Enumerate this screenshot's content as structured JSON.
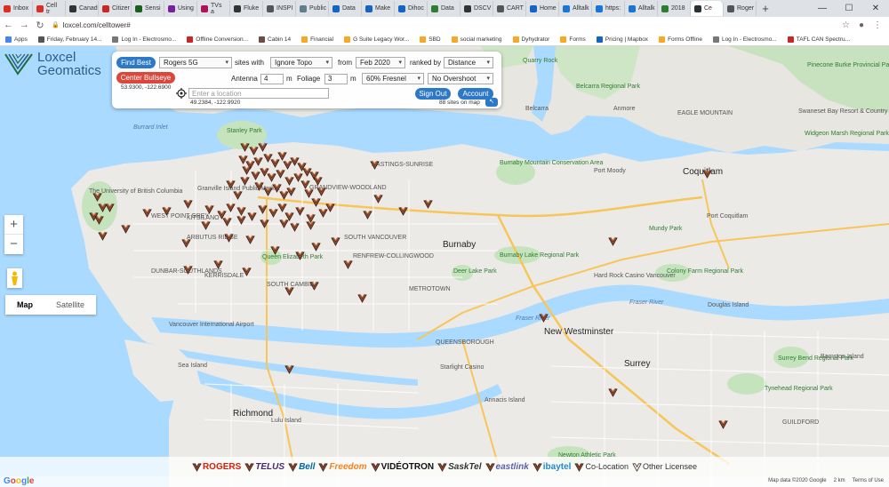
{
  "browser": {
    "tabs": [
      {
        "label": "Inbox",
        "color": "#d93025"
      },
      {
        "label": "Cell tr",
        "color": "#d93025"
      },
      {
        "label": "Canad",
        "color": "#333333"
      },
      {
        "label": "Citizer",
        "color": "#c62828"
      },
      {
        "label": "Sensi",
        "color": "#1b5e20"
      },
      {
        "label": "Using",
        "color": "#7b1fa2"
      },
      {
        "label": "TVs a",
        "color": "#ad1457"
      },
      {
        "label": "Fluke",
        "color": "#333333"
      },
      {
        "label": "INSPI",
        "color": "#555555"
      },
      {
        "label": "Public",
        "color": "#607d8b"
      },
      {
        "label": "Data",
        "color": "#1565c0"
      },
      {
        "label": "Make",
        "color": "#1565c0"
      },
      {
        "label": "Dihoc",
        "color": "#1565c0"
      },
      {
        "label": "Data",
        "color": "#2e7d32"
      },
      {
        "label": "DSCV",
        "color": "#333333"
      },
      {
        "label": "CART",
        "color": "#555555"
      },
      {
        "label": "Home",
        "color": "#1565c0"
      },
      {
        "label": "Alltalk",
        "color": "#1976d2"
      },
      {
        "label": "https:",
        "color": "#1976d2"
      },
      {
        "label": "Alltalk",
        "color": "#1976d2"
      },
      {
        "label": "2018",
        "color": "#2e7d32"
      },
      {
        "label": "Ce",
        "color": "#263238",
        "active": true
      },
      {
        "label": "Roger",
        "color": "#555555"
      }
    ],
    "url": "loxcel.com/celltower#",
    "new_tab": "+",
    "window_buttons": [
      "—",
      "☐",
      "✕"
    ],
    "bookmarks": [
      {
        "label": "Apps",
        "color": "#4285f4"
      },
      {
        "label": "Friday, February 14...",
        "color": "#555555"
      },
      {
        "label": "Log In - Electrosmo...",
        "color": "#777777"
      },
      {
        "label": "Offline Conversion...",
        "color": "#c62828"
      },
      {
        "label": "Cabin 14",
        "color": "#6d4c41"
      },
      {
        "label": "Financial",
        "color": "#f9a825"
      },
      {
        "label": "G Suite Legacy Wor...",
        "color": "#f9a825"
      },
      {
        "label": "SBD",
        "color": "#f9a825"
      },
      {
        "label": "social marketing",
        "color": "#f9a825"
      },
      {
        "label": "Dyhydrator",
        "color": "#f9a825"
      },
      {
        "label": "Forms",
        "color": "#f9a825"
      },
      {
        "label": "Pricing | Mapbox",
        "color": "#1565c0"
      },
      {
        "label": "Forms Offline",
        "color": "#f9a825"
      },
      {
        "label": "Log In - Electrosmo...",
        "color": "#777777"
      },
      {
        "label": "TAFL CAN Spectru...",
        "color": "#c62828"
      }
    ]
  },
  "app": {
    "logo_line1": "Loxcel",
    "logo_line2": "Geomatics",
    "find_best": "Find Best",
    "carrier": "Rogers 5G",
    "sites_with": "sites with",
    "topo": "Ignore Topo",
    "from": "from",
    "date": "Feb 2020",
    "ranked_by": "ranked by",
    "rank": "Distance",
    "center_bullseye": "Center Bullseye",
    "bullseye_coords": "53.9300, -122.6900",
    "antenna_label": "Antenna",
    "antenna_value": "4",
    "antenna_unit": "m",
    "foliage_label": "Foliage",
    "foliage_value": "3",
    "foliage_unit": "m",
    "fresnel": "60% Fresnel",
    "overshoot": "No Overshoot",
    "location_placeholder": "Enter a location",
    "location_coords": "49.2384, -122.9920",
    "sign_out": "Sign Out",
    "account": "Account",
    "sites_count": "88 sites on map",
    "collapse": "↖"
  },
  "map": {
    "zoom_in": "+",
    "zoom_out": "−",
    "map_type": [
      "Map",
      "Satellite"
    ],
    "places": [
      {
        "t": "Quarry Rock",
        "c": "green"
      },
      {
        "t": "Belcarra Regional Park",
        "c": "green"
      },
      {
        "t": "Belcarra",
        "c": ""
      },
      {
        "t": "Anmore",
        "c": ""
      },
      {
        "t": "EAGLE MOUNTAIN",
        "c": ""
      },
      {
        "t": "Swaneset Bay Resort & Country Club",
        "c": ""
      },
      {
        "t": "Pinecone Burke Provincial Park",
        "c": "green"
      },
      {
        "t": "Widgeon Marsh Regional Park",
        "c": "green"
      },
      {
        "t": "Stanley Park",
        "c": "green"
      },
      {
        "t": "Burrard Inlet",
        "c": "water"
      },
      {
        "t": "Port Moody",
        "c": ""
      },
      {
        "t": "Coquitlam",
        "c": "city"
      },
      {
        "t": "Port Coquitlam",
        "c": ""
      },
      {
        "t": "Mundy Park",
        "c": "green"
      },
      {
        "t": "Burnaby Mountain Conservation Area",
        "c": "green"
      },
      {
        "t": "Granville Island Public Market",
        "c": ""
      },
      {
        "t": "GRANDVIEW-WOODLAND",
        "c": ""
      },
      {
        "t": "The University of British Columbia",
        "c": ""
      },
      {
        "t": "WEST POINT GREY",
        "c": ""
      },
      {
        "t": "KITSILANO",
        "c": ""
      },
      {
        "t": "ARBUTUS RIDGE",
        "c": ""
      },
      {
        "t": "Burnaby",
        "c": "city"
      },
      {
        "t": "Queen Elizabeth Park",
        "c": "green"
      },
      {
        "t": "Burnaby Lake Regional Park",
        "c": "green"
      },
      {
        "t": "DUNBAR-SOUTHLANDS",
        "c": ""
      },
      {
        "t": "KERRISDALE",
        "c": ""
      },
      {
        "t": "Deer Lake Park",
        "c": "green"
      },
      {
        "t": "Hard Rock Casino Vancouver",
        "c": ""
      },
      {
        "t": "Colony Farm Regional Park",
        "c": "green"
      },
      {
        "t": "METROTOWN",
        "c": ""
      },
      {
        "t": "Douglas Island",
        "c": ""
      },
      {
        "t": "New Westminster",
        "c": "city"
      },
      {
        "t": "Vancouver International Airport",
        "c": ""
      },
      {
        "t": "Sea Island",
        "c": ""
      },
      {
        "t": "Starlight Casino",
        "c": ""
      },
      {
        "t": "Surrey",
        "c": "city"
      },
      {
        "t": "Surrey Bend Regional Park",
        "c": "green"
      },
      {
        "t": "Barnston Island",
        "c": ""
      },
      {
        "t": "Tynehead Regional Park",
        "c": "green"
      },
      {
        "t": "Annacis Island",
        "c": ""
      },
      {
        "t": "Richmond",
        "c": "city"
      },
      {
        "t": "Lulu Island",
        "c": ""
      },
      {
        "t": "Newton Athletic Park",
        "c": "green"
      },
      {
        "t": "Fraser River",
        "c": "water"
      },
      {
        "t": "Fraser River",
        "c": "water"
      },
      {
        "t": "HASTINGS-SUNRISE",
        "c": ""
      },
      {
        "t": "RENFREW-COLLINGWOOD",
        "c": ""
      },
      {
        "t": "SOUTH VANCOUVER",
        "c": ""
      },
      {
        "t": "SOUTH CAMBIE",
        "c": ""
      },
      {
        "t": "GUILDFORD",
        "c": ""
      },
      {
        "t": "QUEENSBOROUGH",
        "c": ""
      }
    ]
  },
  "legend": [
    {
      "label": "ROGERS",
      "color": "#d81e05",
      "italic": false
    },
    {
      "label": "TELUS",
      "color": "#4b286d",
      "italic": true
    },
    {
      "label": "Bell",
      "color": "#0066a4",
      "italic": true
    },
    {
      "label": "Freedom",
      "color": "#f58220",
      "italic": true
    },
    {
      "label": "VIDÉOTRON",
      "color": "#111111",
      "italic": false
    },
    {
      "label": "SaskTel",
      "color": "#333333",
      "italic": true
    },
    {
      "label": "eastlink",
      "color": "#5a5fa8",
      "italic": true
    },
    {
      "label": "ibaytel",
      "color": "#1e88c8",
      "italic": false
    },
    {
      "label": "Co-Location",
      "color": "#333333",
      "plain": true
    },
    {
      "label": "Other Licensee",
      "color": "#333333",
      "plain": true
    }
  ],
  "footer": {
    "google": "Google",
    "map_data": "Map data ©2020 Google",
    "scale": "2 km",
    "terms": "Terms of Use"
  }
}
